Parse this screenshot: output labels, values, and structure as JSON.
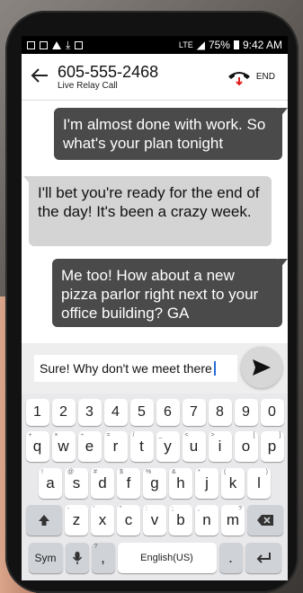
{
  "status_bar": {
    "battery": "75%",
    "time": "9:42 AM",
    "signal_label": "LTE"
  },
  "header": {
    "back_icon": "back-arrow-icon",
    "phone_number": "605-555-2468",
    "subtitle": "Live Relay Call",
    "end_label": "END"
  },
  "messages": [
    {
      "direction": "outgoing",
      "text": "I'm almost done with work. So what's your plan tonight"
    },
    {
      "direction": "incoming",
      "text": "I'll bet you're ready for the end of the day! It's been a crazy week."
    },
    {
      "direction": "outgoing",
      "text": "Me too! How about a new pizza parlor right next to your office building? GA"
    }
  ],
  "compose": {
    "value": "Sure! Why don't we meet there"
  },
  "keyboard": {
    "numbers": [
      "1",
      "2",
      "3",
      "4",
      "5",
      "6",
      "7",
      "8",
      "9",
      "0"
    ],
    "row1": [
      {
        "k": "q",
        "h": "+"
      },
      {
        "k": "w",
        "h": "×"
      },
      {
        "k": "e",
        "h": "÷"
      },
      {
        "k": "r",
        "h": "="
      },
      {
        "k": "t",
        "h": "/"
      },
      {
        "k": "y",
        "h": "_"
      },
      {
        "k": "u",
        "h": "<"
      },
      {
        "k": "i",
        "h": ">"
      },
      {
        "k": "o",
        "h": "["
      },
      {
        "k": "p",
        "h": "]"
      }
    ],
    "row2": [
      {
        "k": "a",
        "h": "!"
      },
      {
        "k": "s",
        "h": "@"
      },
      {
        "k": "d",
        "h": "#"
      },
      {
        "k": "f",
        "h": "$"
      },
      {
        "k": "g",
        "h": "%"
      },
      {
        "k": "h",
        "h": "&"
      },
      {
        "k": "j",
        "h": "*"
      },
      {
        "k": "k",
        "h": "("
      },
      {
        "k": "l",
        "h": ")"
      }
    ],
    "row3": [
      {
        "k": "z",
        "h": "-"
      },
      {
        "k": "x",
        "h": "'"
      },
      {
        "k": "c",
        "h": "\""
      },
      {
        "k": "v",
        "h": ":"
      },
      {
        "k": "b",
        "h": ";"
      },
      {
        "k": "n",
        "h": ","
      },
      {
        "k": "m",
        "h": "?"
      }
    ],
    "sym_label": "Sym",
    "comma": ",",
    "comma_hint": "?",
    "space_label": "English(US)",
    "period": "."
  },
  "colors": {
    "outgoing_bubble": "#4a4a4a",
    "incoming_bubble": "#d4d4d4",
    "end_icon_red": "#e02020"
  }
}
